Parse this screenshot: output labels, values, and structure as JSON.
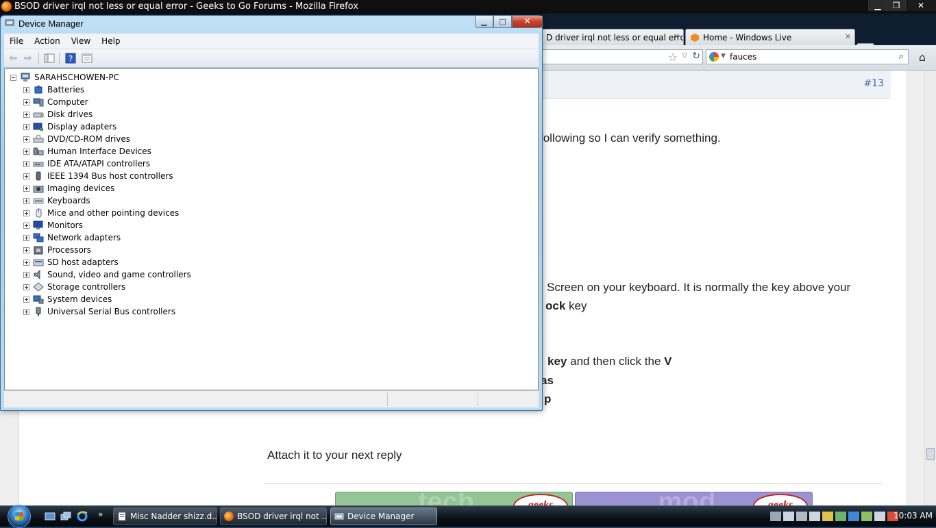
{
  "firefox": {
    "title": "BSOD driver irql not less or equal error - Geeks to Go Forums - Mozilla Firefox",
    "tabs": [
      {
        "label": "D driver irql not less or equal erro..."
      },
      {
        "label": "Home - Windows Live"
      }
    ],
    "new_tab": "+",
    "search_value": "fauces",
    "post_number": "#13",
    "text_lines": [
      "following so I can verify something.",
      "Screen on your keyboard. It is normally the key above your",
      "ock",
      "key",
      "key",
      "and then click the",
      "V",
      "as",
      "p",
      "Attach it to your next reply"
    ]
  },
  "device_manager": {
    "title": "Device Manager",
    "menu": [
      "File",
      "Action",
      "View",
      "Help"
    ],
    "root": "SARAHSCHOWEN-PC",
    "items": [
      {
        "label": "Batteries",
        "icon": "battery-icon"
      },
      {
        "label": "Computer",
        "icon": "computer-icon"
      },
      {
        "label": "Disk drives",
        "icon": "disk-icon"
      },
      {
        "label": "Display adapters",
        "icon": "display-icon"
      },
      {
        "label": "DVD/CD-ROM drives",
        "icon": "dvd-icon"
      },
      {
        "label": "Human Interface Devices",
        "icon": "hid-icon"
      },
      {
        "label": "IDE ATA/ATAPI controllers",
        "icon": "ide-icon"
      },
      {
        "label": "IEEE 1394 Bus host controllers",
        "icon": "firewire-icon"
      },
      {
        "label": "Imaging devices",
        "icon": "camera-icon"
      },
      {
        "label": "Keyboards",
        "icon": "keyboard-icon"
      },
      {
        "label": "Mice and other pointing devices",
        "icon": "mouse-icon"
      },
      {
        "label": "Monitors",
        "icon": "monitor-icon"
      },
      {
        "label": "Network adapters",
        "icon": "network-icon"
      },
      {
        "label": "Processors",
        "icon": "cpu-icon"
      },
      {
        "label": "SD host adapters",
        "icon": "sd-icon"
      },
      {
        "label": "Sound, video and game controllers",
        "icon": "speaker-icon"
      },
      {
        "label": "Storage controllers",
        "icon": "storage-icon"
      },
      {
        "label": "System devices",
        "icon": "system-icon"
      },
      {
        "label": "Universal Serial Bus controllers",
        "icon": "usb-icon"
      }
    ]
  },
  "taskbar": {
    "buttons": [
      {
        "label": "Misc Nadder shizz.d..."
      },
      {
        "label": "BSOD driver irql not ..."
      },
      {
        "label": "Device Manager"
      }
    ],
    "clock": "10:03 AM"
  }
}
